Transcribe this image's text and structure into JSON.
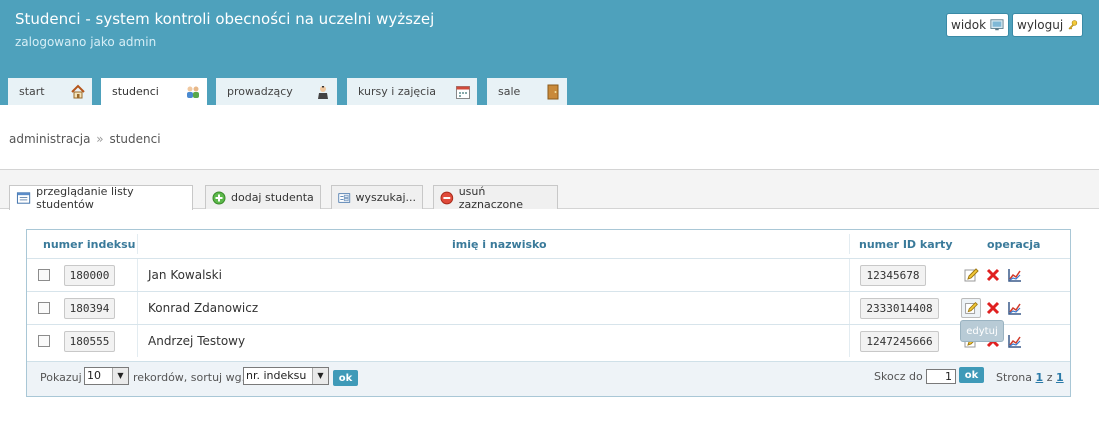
{
  "header": {
    "title": "Studenci - system kontroli obecności na uczelni wyższej",
    "login_info": "zalogowano jako admin",
    "view_button": "widok",
    "logout_button": "wyloguj"
  },
  "tabs": [
    {
      "label": "start",
      "icon": "home-icon"
    },
    {
      "label": "studenci",
      "icon": "students-icon"
    },
    {
      "label": "prowadzący",
      "icon": "teacher-icon"
    },
    {
      "label": "kursy i zajęcia",
      "icon": "calendar-icon"
    },
    {
      "label": "sale",
      "icon": "door-icon"
    }
  ],
  "breadcrumb": {
    "root": "administracja",
    "separator": "»",
    "current": "studenci"
  },
  "subtabs": [
    {
      "label": "przeglądanie listy studentów",
      "icon": "list-icon"
    },
    {
      "label": "dodaj studenta",
      "icon": "add-icon"
    },
    {
      "label": "wyszukaj...",
      "icon": "search-form-icon"
    },
    {
      "label": "usuń zaznaczone",
      "icon": "remove-icon"
    }
  ],
  "table": {
    "columns": [
      "numer indeksu",
      "imię i nazwisko",
      "numer ID karty",
      "operacja"
    ],
    "rows": [
      {
        "index": "180000",
        "name": "Jan Kowalski",
        "card_id": "12345678"
      },
      {
        "index": "180394",
        "name": "Konrad Zdanowicz",
        "card_id": "2333014408"
      },
      {
        "index": "180555",
        "name": "Andrzej Testowy",
        "card_id": "1247245666"
      }
    ],
    "tooltip": "edytuj"
  },
  "footer": {
    "show_label": "Pokazuj",
    "per_page": "10",
    "records_sort_label": "rekordów, sortuj wg.",
    "sort_by": "nr. indeksu ↑",
    "ok_label": "ok",
    "jump_label": "Skocz do",
    "jump_value": "1",
    "page_label": "Strona",
    "page_current": "1",
    "page_of": "z",
    "page_total": "1"
  },
  "colors": {
    "header": "#4ea1bc",
    "accent": "#3f9ab8",
    "delete": "#e02020"
  }
}
